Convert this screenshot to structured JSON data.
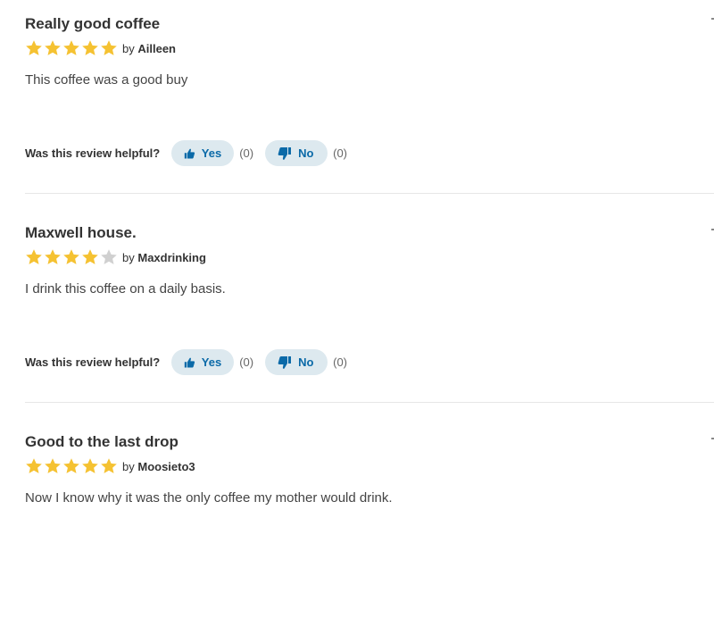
{
  "reviews": [
    {
      "title": "Really good coffee",
      "rating": 5,
      "max_rating": 5,
      "by_prefix": "by",
      "author": "Ailleen",
      "body": "This coffee was a good buy",
      "helpful_label": "Was this review helpful?",
      "yes_label": "Yes",
      "yes_count": "(0)",
      "no_label": "No",
      "no_count": "(0)"
    },
    {
      "title": "Maxwell house.",
      "rating": 4,
      "max_rating": 5,
      "by_prefix": "by",
      "author": "Maxdrinking",
      "body": "I drink this coffee on a daily basis.",
      "helpful_label": "Was this review helpful?",
      "yes_label": "Yes",
      "yes_count": "(0)",
      "no_label": "No",
      "no_count": "(0)"
    },
    {
      "title": "Good to the last drop",
      "rating": 5,
      "max_rating": 5,
      "by_prefix": "by",
      "author": "Moosieto3",
      "body": "Now I know why it was the only coffee my mother would drink."
    }
  ],
  "colors": {
    "star_filled": "#f5c232",
    "star_empty": "#d0d0d0",
    "button_bg": "#dde9ef",
    "button_text": "#0b6aa8",
    "divider": "#e6e6e6"
  },
  "icons": {
    "star": "star-icon",
    "thumbs_up": "thumbs-up-icon",
    "thumbs_down": "thumbs-down-icon"
  }
}
